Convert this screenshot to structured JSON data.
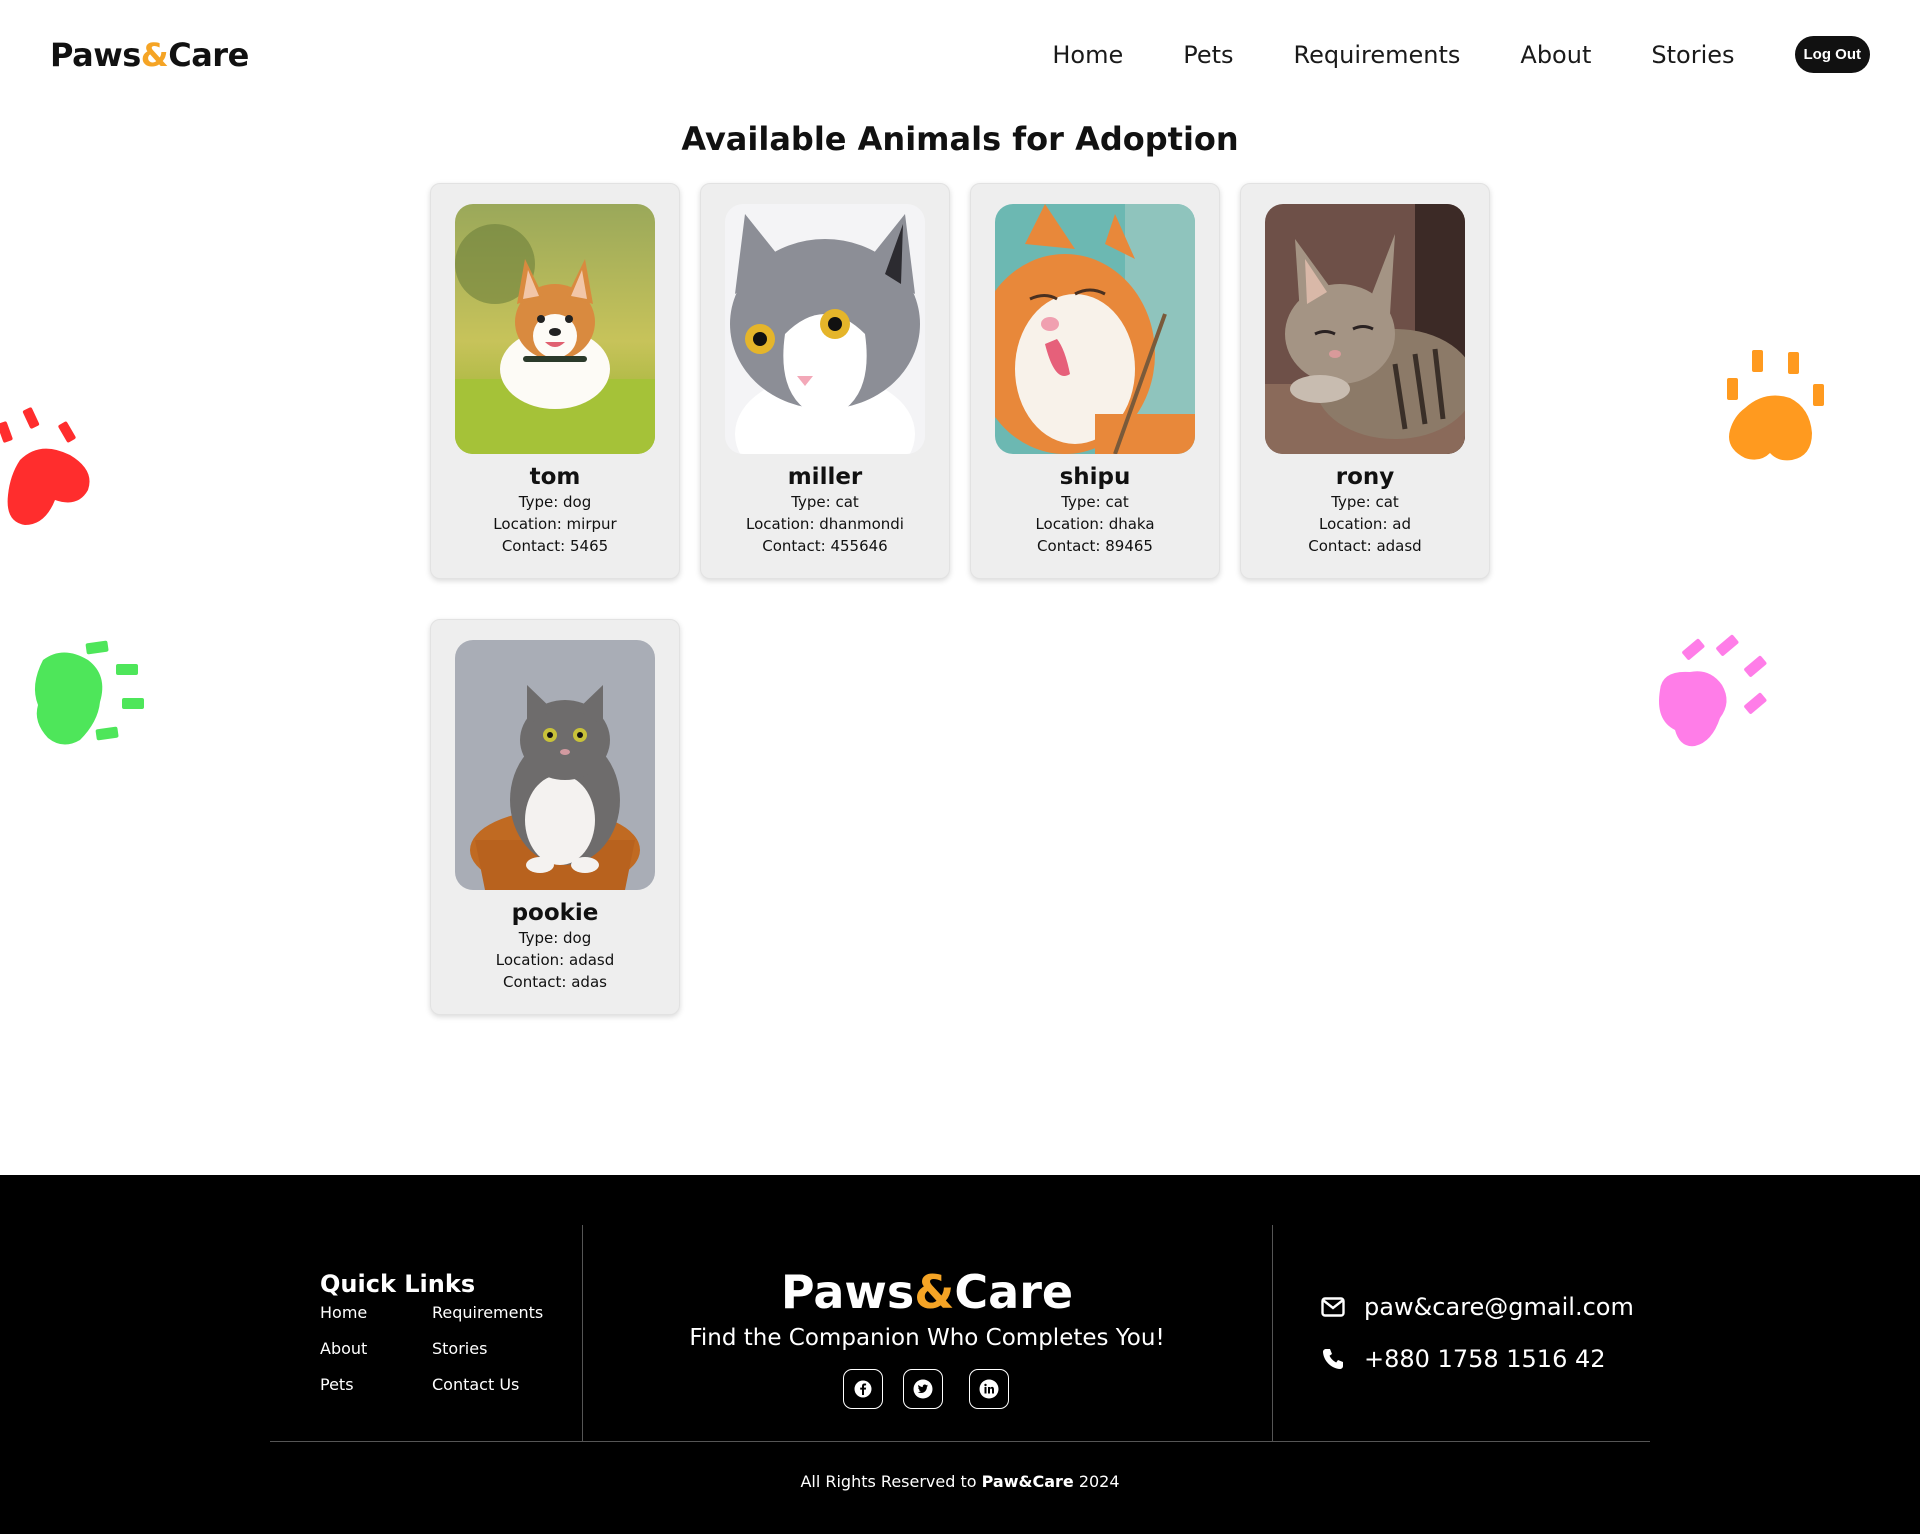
{
  "header": {
    "brand": {
      "part1": "Paws",
      "amp": "&",
      "part2": "Care"
    },
    "nav": [
      "Home",
      "Pets",
      "Requirements",
      "About",
      "Stories"
    ],
    "logout_label": "Log Out"
  },
  "main": {
    "title": "Available Animals for Adoption",
    "animals": [
      {
        "name": "tom",
        "type": "Type: dog",
        "location": "Location: mirpur",
        "contact": "Contact: 5465"
      },
      {
        "name": "miller",
        "type": "Type: cat",
        "location": "Location: dhanmondi",
        "contact": "Contact: 455646"
      },
      {
        "name": "shipu",
        "type": "Type: cat",
        "location": "Location: dhaka",
        "contact": "Contact: 89465"
      },
      {
        "name": "rony",
        "type": "Type: cat",
        "location": "Location: ad",
        "contact": "Contact: adasd"
      },
      {
        "name": "pookie",
        "type": "Type: dog",
        "location": "Location: adasd",
        "contact": "Contact: adas"
      }
    ]
  },
  "decor": {
    "paw_colors": {
      "red": "#ff2d2d",
      "orange": "#ff9a1f",
      "green": "#4ee65a",
      "pink": "#ff7de8"
    }
  },
  "footer": {
    "quick_links_title": "Quick Links",
    "quick_links": [
      "Home",
      "Requirements",
      "About",
      "Stories",
      "Pets",
      "Contact Us"
    ],
    "brand": {
      "part1": "Paws",
      "amp": "&",
      "part2": "Care"
    },
    "tagline": "Find the Companion Who Completes You!",
    "social": [
      "facebook-icon",
      "twitter-icon",
      "linkedin-icon"
    ],
    "email": "paw&care@gmail.com",
    "phone": "+880 1758 1516 42",
    "copyright": {
      "prefix": "All Rights Reserved to ",
      "brand": "Paw&Care",
      "suffix": " 2024"
    }
  },
  "colors": {
    "accent": "#f5a425",
    "footer_bg": "#000000",
    "card_bg": "#eeeeee"
  }
}
